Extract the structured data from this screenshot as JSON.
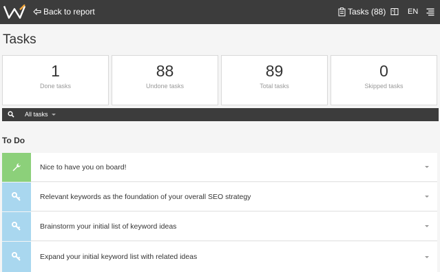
{
  "header": {
    "back_label": "Back to report",
    "tasks_label": "Tasks (88)",
    "language": "EN",
    "bar_color": "#3c3c3c"
  },
  "page": {
    "title": "Tasks"
  },
  "stats": [
    {
      "value": "1",
      "label": "Done tasks"
    },
    {
      "value": "88",
      "label": "Undone tasks"
    },
    {
      "value": "89",
      "label": "Total tasks"
    },
    {
      "value": "0",
      "label": "Skipped tasks"
    }
  ],
  "filter": {
    "selected": "All tasks"
  },
  "section": {
    "title": "To Do"
  },
  "tasks": [
    {
      "label": "Nice to have you on board!",
      "icon": "wrench-icon",
      "color": "#8cd07a"
    },
    {
      "label": "Relevant keywords as the foundation of your overall SEO strategy",
      "icon": "key-icon",
      "color": "#a9d7ef"
    },
    {
      "label": "Brainstorm your initial list of keyword ideas",
      "icon": "key-icon",
      "color": "#a9d7ef"
    },
    {
      "label": "Expand your initial keyword list with related ideas",
      "icon": "key-icon",
      "color": "#a9d7ef"
    }
  ]
}
